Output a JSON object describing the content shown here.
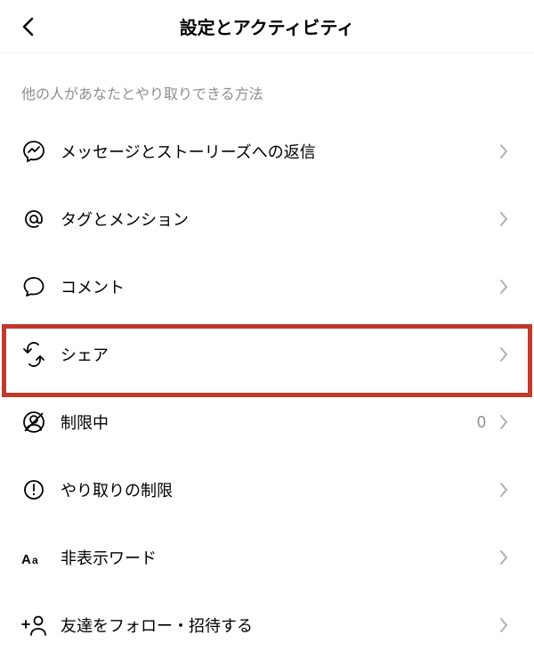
{
  "header": {
    "title": "設定とアクティビティ"
  },
  "section": {
    "heading": "他の人があなたとやり取りできる方法"
  },
  "rows": [
    {
      "icon": "messenger-icon",
      "label": "メッセージとストーリーズへの返信",
      "value": ""
    },
    {
      "icon": "at-icon",
      "label": "タグとメンション",
      "value": ""
    },
    {
      "icon": "comment-icon",
      "label": "コメント",
      "value": ""
    },
    {
      "icon": "share-icon",
      "label": "シェア",
      "value": ""
    },
    {
      "icon": "restrict-icon",
      "label": "制限中",
      "value": "0"
    },
    {
      "icon": "limits-icon",
      "label": "やり取りの制限",
      "value": ""
    },
    {
      "icon": "hidden-words-icon",
      "label": "非表示ワード",
      "value": ""
    },
    {
      "icon": "add-friend-icon",
      "label": "友達をフォロー・招待する",
      "value": ""
    }
  ]
}
